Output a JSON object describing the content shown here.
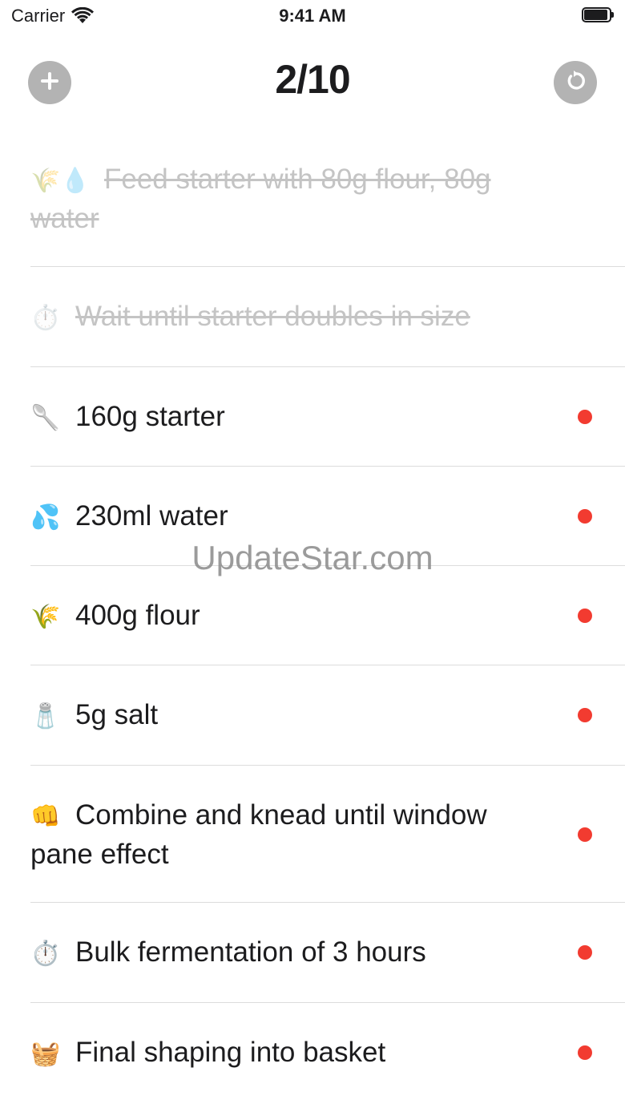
{
  "status_bar": {
    "carrier": "Carrier",
    "time": "9:41 AM"
  },
  "header": {
    "title": "2/10",
    "add_icon": "plus-icon",
    "reset_icon": "refresh-icon",
    "button_color": "#b3b3b3"
  },
  "steps": [
    {
      "emoji": "🌾💧",
      "text": "Feed starter with 80g flour, 80g water",
      "done": true
    },
    {
      "emoji": "⏱️",
      "text": "Wait until starter doubles in size",
      "done": true
    },
    {
      "emoji": "🥄",
      "text": "160g starter",
      "done": false
    },
    {
      "emoji": "💦",
      "text": "230ml water",
      "done": false
    },
    {
      "emoji": "🌾",
      "text": "400g flour",
      "done": false
    },
    {
      "emoji": "🧂",
      "text": "5g salt",
      "done": false
    },
    {
      "emoji": "👊",
      "text": "Combine and knead until window pane effect",
      "done": false
    },
    {
      "emoji": "⏱️",
      "text": "Bulk fermentation of 3 hours",
      "done": false
    },
    {
      "emoji": "🧺",
      "text": "Final shaping into basket",
      "done": false
    }
  ],
  "colors": {
    "pending_dot": "#f23b30",
    "done_text": "#c4c4c4",
    "separator": "#dcdcdc"
  },
  "watermark": "UpdateStar.com"
}
